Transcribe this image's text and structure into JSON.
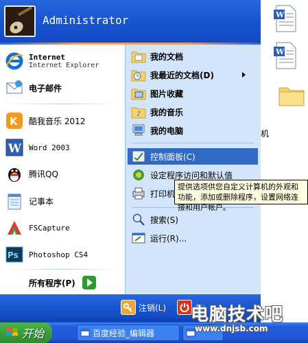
{
  "user": {
    "name": "Administrator"
  },
  "left_pinned": [
    {
      "title": "Internet",
      "subtitle": "Internet Explorer",
      "icon": "ie-icon"
    },
    {
      "title": "电子邮件",
      "icon": "mail-icon"
    }
  ],
  "left_recent": [
    {
      "label": "酷我音乐 2012",
      "icon": "kuwo-icon"
    },
    {
      "label": "Word 2003",
      "icon": "word-icon"
    },
    {
      "label": "腾讯QQ",
      "icon": "qq-penguin-icon"
    },
    {
      "label": "记事本",
      "icon": "notepad-icon"
    },
    {
      "label": "FSCapture",
      "icon": "fscapture-icon"
    },
    {
      "label": "Photoshop CS4",
      "icon": "photoshop-icon"
    }
  ],
  "all_programs": {
    "label": "所有程序(P)"
  },
  "right_items": {
    "my_documents": "我的文档",
    "recent_docs": "我最近的文档(D)",
    "my_pictures": "图片收藏",
    "my_music": "我的音乐",
    "my_computer": "我的电脑",
    "control_panel": "控制面板(C)",
    "default_programs": "设定程序访问和默认值",
    "printers": "打印机",
    "search": "搜索(S)",
    "run": "运行(R)..."
  },
  "tooltip": {
    "text": "提供选项供您自定义计算机的外观和功能，添加或删除程序，设置网络连接和用户帐户。"
  },
  "footer": {
    "logoff": "注销(L)",
    "shutdown": "关闭计算机(U)"
  },
  "taskbar": {
    "start_label": "开始",
    "tasks": [
      {
        "label": "百度经验_编辑器"
      },
      {
        "label": ""
      }
    ]
  },
  "behind_window": {
    "partial_text": "算机"
  },
  "watermark": {
    "main": "电脑技术吧",
    "url": "www.dnjsb.com"
  },
  "colors": {
    "header_blue": "#1755d0",
    "highlight": "#316ac5",
    "right_pane": "#d3e5fa",
    "start_green": "#3c9d3c"
  }
}
